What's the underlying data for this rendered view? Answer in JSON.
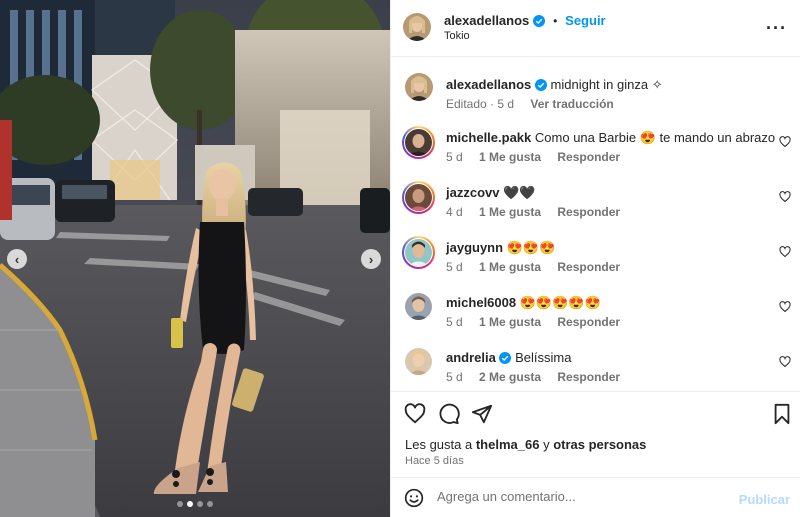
{
  "colors": {
    "link": "#0095f6",
    "verified": "#0095f6",
    "publish_disabled": "#b3dbff",
    "text": "#262626",
    "muted": "#737373"
  },
  "header": {
    "username": "alexadellanos",
    "separator": "•",
    "follow_label": "Seguir",
    "location": "Tokio",
    "more_icon": "more-horizontal-icon"
  },
  "photo": {
    "carousel_dots": 4,
    "active_dot": 2,
    "prev_icon": "chevron-left-icon",
    "next_icon": "chevron-right-icon"
  },
  "caption": {
    "username": "alexadellanos",
    "text": "midnight in ginza ✧",
    "edited": "Editado · 5 d",
    "translate": "Ver traducción"
  },
  "comments": [
    {
      "username": "michelle.pakk",
      "text": "Como una Barbie 😍 te mando un abrazo",
      "age": "5 d",
      "likes": "1 Me gusta",
      "reply": "Responder",
      "verified": false,
      "story_ring": true
    },
    {
      "username": "jazzcovv",
      "text": "🖤🖤",
      "age": "4 d",
      "likes": "1 Me gusta",
      "reply": "Responder",
      "verified": false,
      "story_ring": true
    },
    {
      "username": "jayguynn",
      "text": "😍😍😍",
      "age": "5 d",
      "likes": "1 Me gusta",
      "reply": "Responder",
      "verified": false,
      "story_ring": true
    },
    {
      "username": "michel6008",
      "text": "😍😍😍😍😍",
      "age": "5 d",
      "likes": "1 Me gusta",
      "reply": "Responder",
      "verified": false,
      "story_ring": false
    },
    {
      "username": "andrelia",
      "text": "Belíssima",
      "age": "5 d",
      "likes": "2 Me gusta",
      "reply": "Responder",
      "verified": true,
      "story_ring": false
    }
  ],
  "actions": {
    "icons": [
      "heart-icon",
      "comment-icon",
      "share-icon",
      "bookmark-icon"
    ],
    "likes_prefix": "Les gusta a",
    "likes_user": "thelma_66",
    "likes_and": "y",
    "likes_others": "otras personas",
    "posted": "Hace 5 días"
  },
  "composer": {
    "placeholder": "Agrega un comentario...",
    "value": "",
    "publish_label": "Publicar",
    "emoji_icon": "emoji-icon"
  }
}
